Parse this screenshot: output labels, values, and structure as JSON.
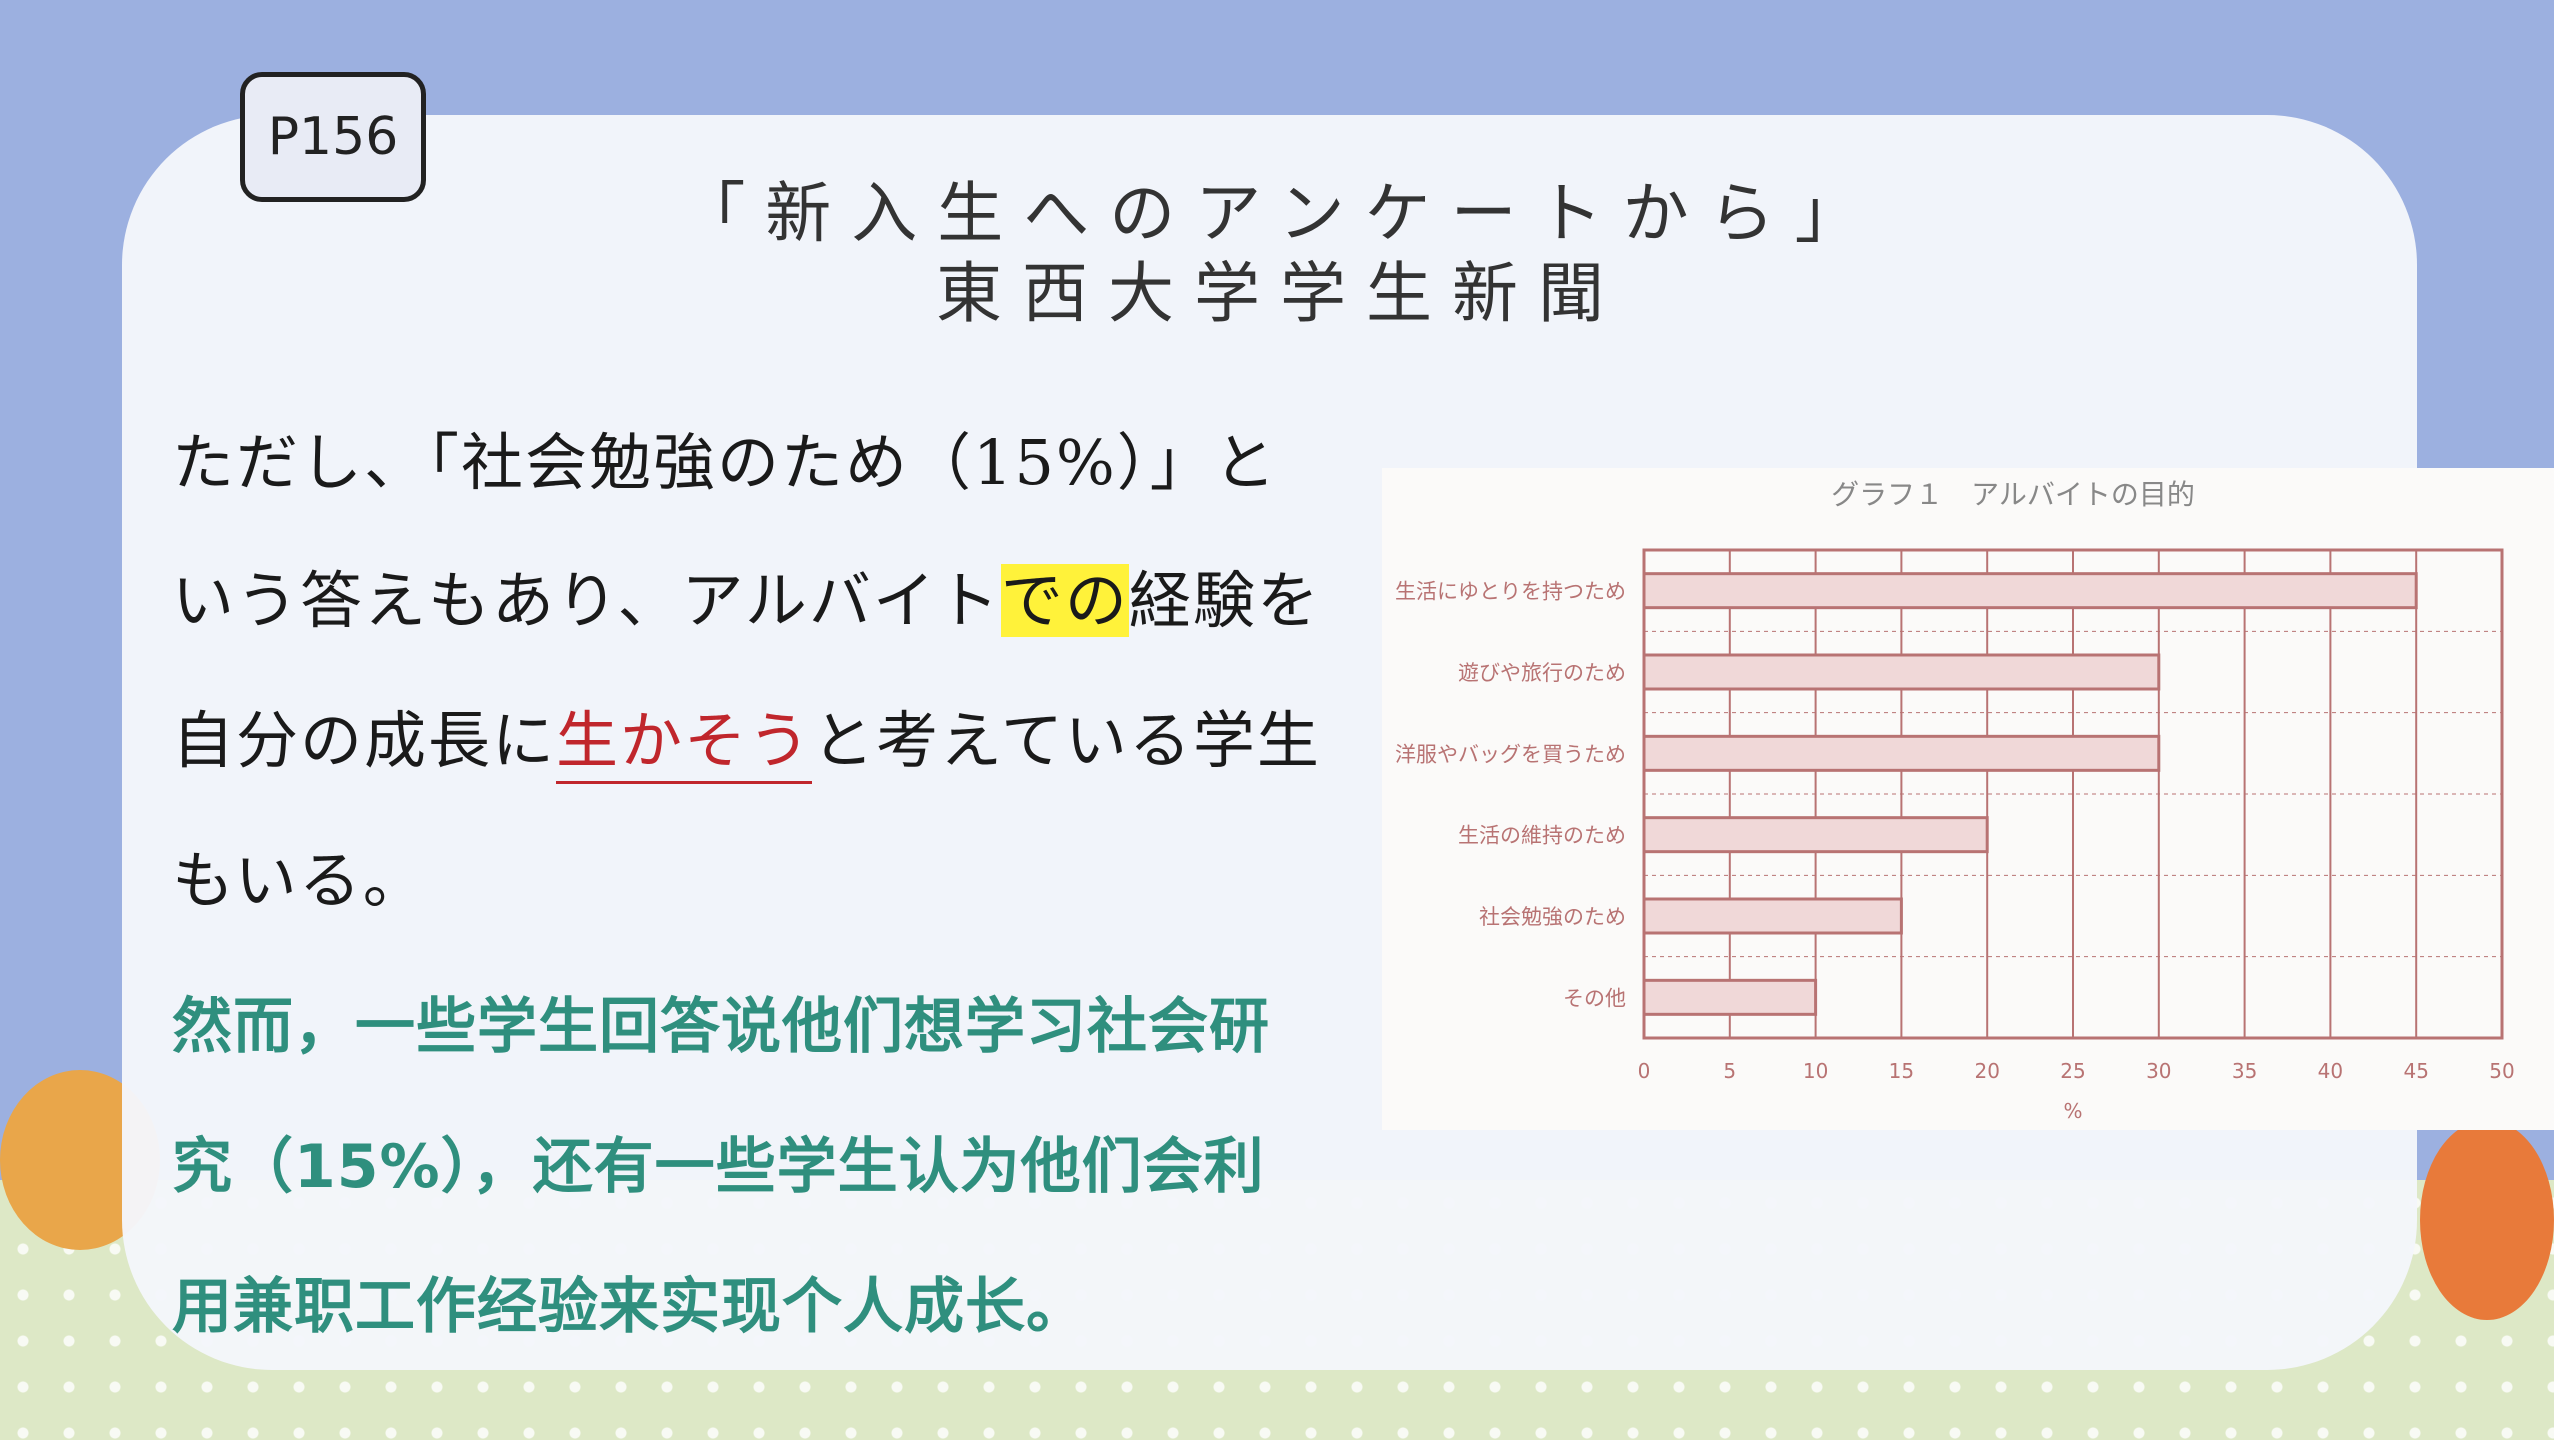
{
  "page_badge": "P156",
  "title": {
    "line1": "「新入生へのアンケートから」",
    "line2": "東西大学学生新聞"
  },
  "japanese_text": {
    "line1": "ただし、「社会勉強のため（15%）」と",
    "line2_a": "いう答えもあり、アルバイト",
    "line2_highlight": "での",
    "line2_b": "経験を",
    "line3_a": "自分の成長に",
    "line3_emphasis": "生かそう",
    "line3_b": "と考えている学生",
    "line4": "もいる。"
  },
  "chinese_text": {
    "line1": "然而，一些学生回答说他们想学习社会研",
    "line2": "究（15%），还有一些学生认为他们会利",
    "line3": "用兼职工作经验来实现个人成长。"
  },
  "colors": {
    "background": "#9cb0e0",
    "highlight": "#fff23a",
    "emphasis": "#c0262c",
    "chinese_text": "#2f8f7e",
    "bar_fill": "#f0d8d8",
    "chart_ink": "#b87373"
  },
  "chart_data": {
    "type": "bar",
    "orientation": "horizontal",
    "title": "グラフ１　アルバイトの目的",
    "categories": [
      "生活にゆとりを持つため",
      "遊びや旅行のため",
      "洋服やバッグを買うため",
      "生活の維持のため",
      "社会勉強のため",
      "その他"
    ],
    "values": [
      45,
      30,
      30,
      20,
      15,
      10
    ],
    "x_ticks": [
      "0",
      "5",
      "10",
      "15",
      "20",
      "25",
      "30",
      "35",
      "40",
      "45",
      "50"
    ],
    "xlabel": "%",
    "xlim": [
      0,
      50
    ],
    "grid": true
  }
}
